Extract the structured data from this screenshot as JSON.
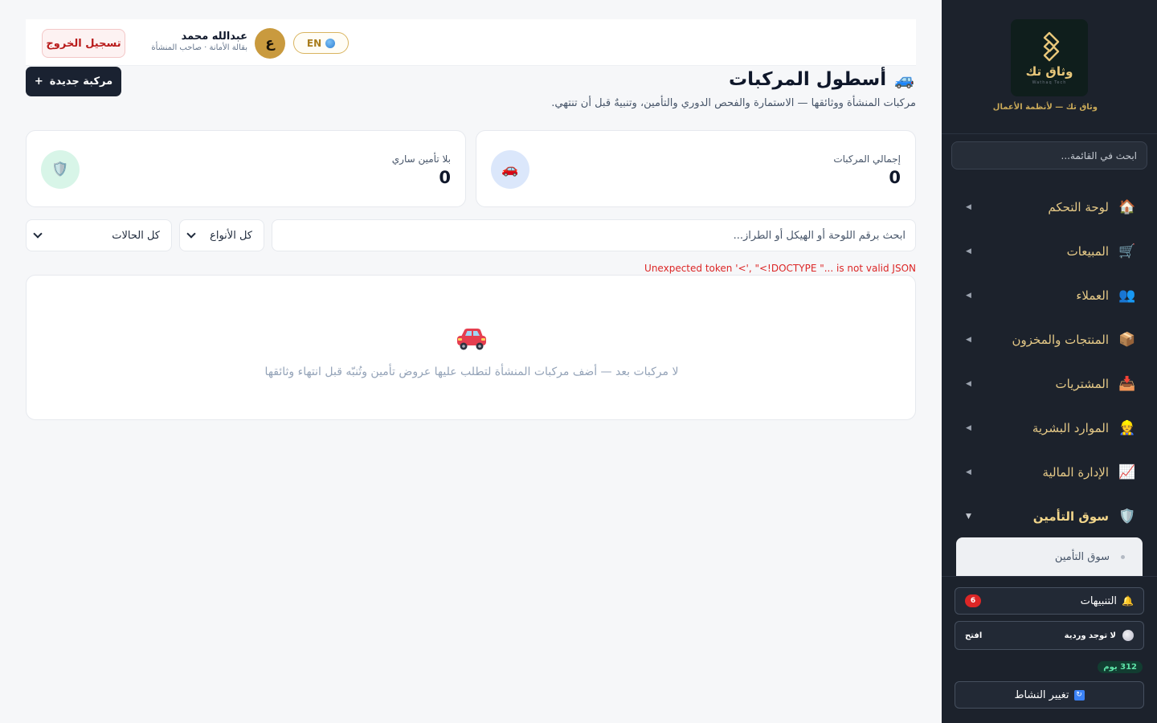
{
  "sidebar": {
    "logo_text": "وثاق تك",
    "logo_subtext": "Wathaq Tech",
    "tagline": "وثاق تك — لأنظمة الأعمال",
    "search_placeholder": "ابحث في القائمة...",
    "items": [
      {
        "label": "لوحة التحكم",
        "icon": "house-icon"
      },
      {
        "label": "المبيعات",
        "icon": "cart-icon"
      },
      {
        "label": "العملاء",
        "icon": "users-icon"
      },
      {
        "label": "المنتجات والمخزون",
        "icon": "package-icon"
      },
      {
        "label": "المشتريات",
        "icon": "inbox-icon"
      },
      {
        "label": "الموارد البشرية",
        "icon": "worker-icon"
      },
      {
        "label": "الإدارة المالية",
        "icon": "chart-icon"
      },
      {
        "label": "سوق التأمين",
        "icon": "shield-icon",
        "active": true
      }
    ],
    "sub_items": [
      {
        "label": "سوق التأمين"
      }
    ],
    "alerts_label": "التنبيهات",
    "alerts_count": "6",
    "shift_label": "لا توجد وردية",
    "shift_action": "افتح",
    "days_badge": "312 يوم",
    "switch_label": "تغيير النشاط"
  },
  "header": {
    "logout_label": "تسجيل الخروج",
    "user_name": "عبدالله محمد",
    "user_role": "بقالة الأمانة · صاحب المنشأة",
    "avatar_letter": "ع",
    "lang_label": "EN"
  },
  "page": {
    "title": "أسطول المركبات",
    "description": "مركبات المنشأة ووثائقها — الاستمارة والفحص الدوري والتأمين، وتنبيهٌ قبل أن تنتهي.",
    "new_vehicle_label": "مركبة جديدة",
    "new_vehicle_prefix": "+"
  },
  "stats": [
    {
      "label": "إجمالي المركبات",
      "value": "0",
      "icon": "car-icon",
      "color": "#dbe7fb"
    },
    {
      "label": "بلا تأمين ساري",
      "value": "0",
      "icon": "shield-icon",
      "color": "#d8f5e8"
    }
  ],
  "filters": {
    "search_placeholder": "ابحث برقم اللوحة أو الهيكل أو الطراز...",
    "type_select": "كل الأنواع",
    "status_select": "كل الحالات"
  },
  "error": "Unexpected token '<', \"<!DOCTYPE \"... is not valid JSON",
  "empty_state": {
    "message": "لا مركبات بعد — أضف مركبات المنشأة لتطلب عليها عروض تأمين وتُنبّه قبل انتهاء وثائقها"
  },
  "colors": {
    "sidebar_bg": "#1c222c",
    "accent_gold": "#e5c987",
    "primary_dark": "#1a2231",
    "danger": "#dc2626"
  }
}
